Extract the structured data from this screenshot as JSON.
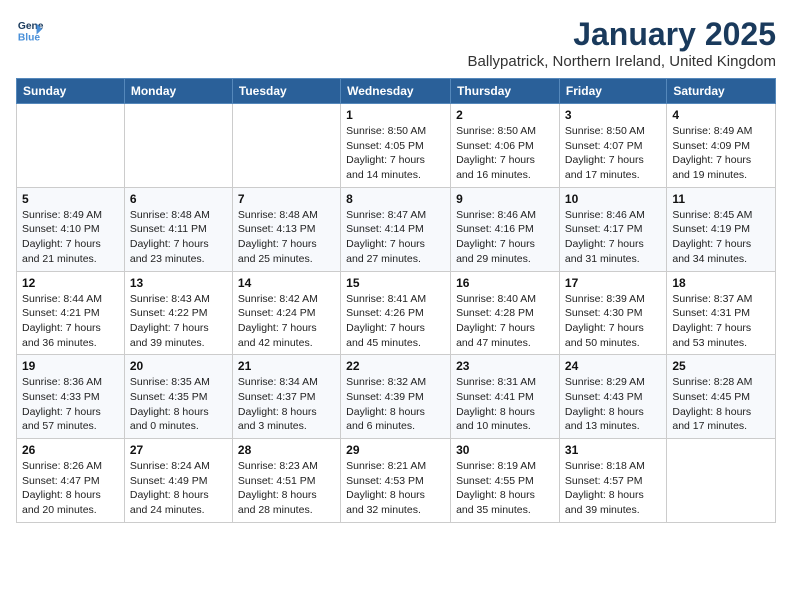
{
  "logo": {
    "line1": "General",
    "line2": "Blue"
  },
  "title": "January 2025",
  "location": "Ballypatrick, Northern Ireland, United Kingdom",
  "weekdays": [
    "Sunday",
    "Monday",
    "Tuesday",
    "Wednesday",
    "Thursday",
    "Friday",
    "Saturday"
  ],
  "weeks": [
    [
      {
        "day": "",
        "info": ""
      },
      {
        "day": "",
        "info": ""
      },
      {
        "day": "",
        "info": ""
      },
      {
        "day": "1",
        "info": "Sunrise: 8:50 AM\nSunset: 4:05 PM\nDaylight: 7 hours\nand 14 minutes."
      },
      {
        "day": "2",
        "info": "Sunrise: 8:50 AM\nSunset: 4:06 PM\nDaylight: 7 hours\nand 16 minutes."
      },
      {
        "day": "3",
        "info": "Sunrise: 8:50 AM\nSunset: 4:07 PM\nDaylight: 7 hours\nand 17 minutes."
      },
      {
        "day": "4",
        "info": "Sunrise: 8:49 AM\nSunset: 4:09 PM\nDaylight: 7 hours\nand 19 minutes."
      }
    ],
    [
      {
        "day": "5",
        "info": "Sunrise: 8:49 AM\nSunset: 4:10 PM\nDaylight: 7 hours\nand 21 minutes."
      },
      {
        "day": "6",
        "info": "Sunrise: 8:48 AM\nSunset: 4:11 PM\nDaylight: 7 hours\nand 23 minutes."
      },
      {
        "day": "7",
        "info": "Sunrise: 8:48 AM\nSunset: 4:13 PM\nDaylight: 7 hours\nand 25 minutes."
      },
      {
        "day": "8",
        "info": "Sunrise: 8:47 AM\nSunset: 4:14 PM\nDaylight: 7 hours\nand 27 minutes."
      },
      {
        "day": "9",
        "info": "Sunrise: 8:46 AM\nSunset: 4:16 PM\nDaylight: 7 hours\nand 29 minutes."
      },
      {
        "day": "10",
        "info": "Sunrise: 8:46 AM\nSunset: 4:17 PM\nDaylight: 7 hours\nand 31 minutes."
      },
      {
        "day": "11",
        "info": "Sunrise: 8:45 AM\nSunset: 4:19 PM\nDaylight: 7 hours\nand 34 minutes."
      }
    ],
    [
      {
        "day": "12",
        "info": "Sunrise: 8:44 AM\nSunset: 4:21 PM\nDaylight: 7 hours\nand 36 minutes."
      },
      {
        "day": "13",
        "info": "Sunrise: 8:43 AM\nSunset: 4:22 PM\nDaylight: 7 hours\nand 39 minutes."
      },
      {
        "day": "14",
        "info": "Sunrise: 8:42 AM\nSunset: 4:24 PM\nDaylight: 7 hours\nand 42 minutes."
      },
      {
        "day": "15",
        "info": "Sunrise: 8:41 AM\nSunset: 4:26 PM\nDaylight: 7 hours\nand 45 minutes."
      },
      {
        "day": "16",
        "info": "Sunrise: 8:40 AM\nSunset: 4:28 PM\nDaylight: 7 hours\nand 47 minutes."
      },
      {
        "day": "17",
        "info": "Sunrise: 8:39 AM\nSunset: 4:30 PM\nDaylight: 7 hours\nand 50 minutes."
      },
      {
        "day": "18",
        "info": "Sunrise: 8:37 AM\nSunset: 4:31 PM\nDaylight: 7 hours\nand 53 minutes."
      }
    ],
    [
      {
        "day": "19",
        "info": "Sunrise: 8:36 AM\nSunset: 4:33 PM\nDaylight: 7 hours\nand 57 minutes."
      },
      {
        "day": "20",
        "info": "Sunrise: 8:35 AM\nSunset: 4:35 PM\nDaylight: 8 hours\nand 0 minutes."
      },
      {
        "day": "21",
        "info": "Sunrise: 8:34 AM\nSunset: 4:37 PM\nDaylight: 8 hours\nand 3 minutes."
      },
      {
        "day": "22",
        "info": "Sunrise: 8:32 AM\nSunset: 4:39 PM\nDaylight: 8 hours\nand 6 minutes."
      },
      {
        "day": "23",
        "info": "Sunrise: 8:31 AM\nSunset: 4:41 PM\nDaylight: 8 hours\nand 10 minutes."
      },
      {
        "day": "24",
        "info": "Sunrise: 8:29 AM\nSunset: 4:43 PM\nDaylight: 8 hours\nand 13 minutes."
      },
      {
        "day": "25",
        "info": "Sunrise: 8:28 AM\nSunset: 4:45 PM\nDaylight: 8 hours\nand 17 minutes."
      }
    ],
    [
      {
        "day": "26",
        "info": "Sunrise: 8:26 AM\nSunset: 4:47 PM\nDaylight: 8 hours\nand 20 minutes."
      },
      {
        "day": "27",
        "info": "Sunrise: 8:24 AM\nSunset: 4:49 PM\nDaylight: 8 hours\nand 24 minutes."
      },
      {
        "day": "28",
        "info": "Sunrise: 8:23 AM\nSunset: 4:51 PM\nDaylight: 8 hours\nand 28 minutes."
      },
      {
        "day": "29",
        "info": "Sunrise: 8:21 AM\nSunset: 4:53 PM\nDaylight: 8 hours\nand 32 minutes."
      },
      {
        "day": "30",
        "info": "Sunrise: 8:19 AM\nSunset: 4:55 PM\nDaylight: 8 hours\nand 35 minutes."
      },
      {
        "day": "31",
        "info": "Sunrise: 8:18 AM\nSunset: 4:57 PM\nDaylight: 8 hours\nand 39 minutes."
      },
      {
        "day": "",
        "info": ""
      }
    ]
  ]
}
